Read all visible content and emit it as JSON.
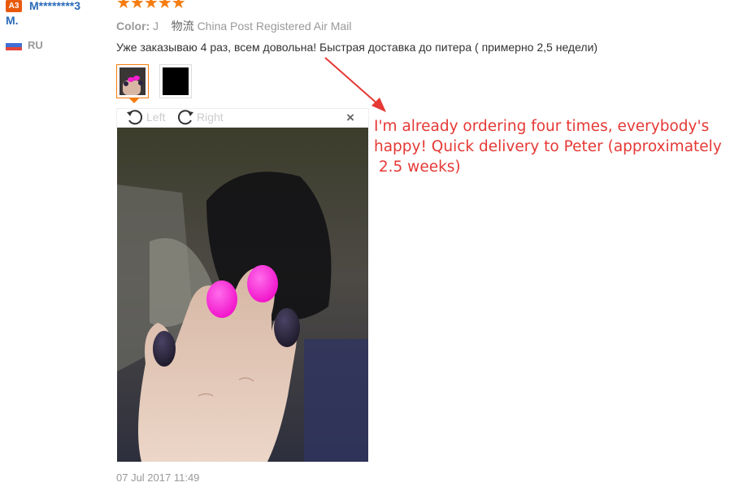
{
  "reviewer": {
    "level_badge": "A3",
    "name_line1": "M********3",
    "name_line2": "M.",
    "country": "RU"
  },
  "review": {
    "stars": "★★★★★",
    "color_label": "Color:",
    "color_value": "J",
    "shipping_cn": "物流",
    "shipping_value": "China Post Registered Air Mail",
    "text": "Уже заказываю 4 раз, всем довольна! Быстрая доставка до питера ( примерно 2,5 недели)",
    "date": "07 Jul 2017 11:49"
  },
  "viewer": {
    "rotate_left_label": "Left",
    "rotate_right_label": "Right",
    "close_label": "×"
  },
  "annotation": {
    "line1": "I'm already ordering four times, everybody's",
    "line2": "happy! Quick delivery to Peter (approximately",
    "line3": " 2.5 weeks)"
  },
  "colors": {
    "accent_orange": "#f57c0f",
    "link_blue": "#2a6ab9",
    "annotation_red": "#e53935",
    "nail_pink": "#ff1fd0",
    "nail_dark": "#2b2540"
  },
  "icons": [
    "rotate-left-icon",
    "rotate-right-icon",
    "close-icon",
    "russia-flag-icon",
    "star-icon"
  ]
}
